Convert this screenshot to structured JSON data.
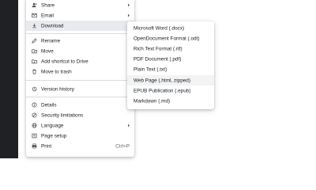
{
  "file_menu": {
    "items": [
      {
        "label": "Share",
        "icon": "person-add-icon",
        "has_submenu": true
      },
      {
        "label": "Email",
        "icon": "email-icon",
        "has_submenu": true
      },
      {
        "label": "Download",
        "icon": "download-icon",
        "has_submenu": true,
        "highlighted": true
      },
      {
        "label": "Rename",
        "icon": "pencil-icon"
      },
      {
        "label": "Move",
        "icon": "folder-move-icon"
      },
      {
        "label": "Add shortcut to Drive",
        "icon": "drive-shortcut-icon"
      },
      {
        "label": "Move to trash",
        "icon": "trash-icon"
      },
      {
        "label": "Version history",
        "icon": "history-icon",
        "has_submenu": true
      },
      {
        "label": "Details",
        "icon": "info-icon"
      },
      {
        "label": "Security limitations",
        "icon": "security-icon"
      },
      {
        "label": "Language",
        "icon": "globe-icon",
        "has_submenu": true
      },
      {
        "label": "Page setup",
        "icon": "page-setup-icon"
      },
      {
        "label": "Print",
        "icon": "print-icon",
        "shortcut": "Ctrl+P"
      }
    ]
  },
  "download_submenu": {
    "items": [
      {
        "label": "Microsoft Word (.docx)"
      },
      {
        "label": "OpenDocument Format (.odt)"
      },
      {
        "label": "Rich Text Format (.rtf)"
      },
      {
        "label": "PDF Document (.pdf)"
      },
      {
        "label": "Plain Text (.txt)"
      },
      {
        "label": "Web Page (.html, zipped)",
        "highlighted": true
      },
      {
        "label": "EPUB Publication (.epub)"
      },
      {
        "label": "Markdown (.md)"
      }
    ]
  },
  "colors": {
    "menu_highlight": "#e8eaed",
    "submenu_highlight": "#f1f3f4",
    "left_panel": "#202124",
    "text": "#202124",
    "icon": "#444746"
  }
}
